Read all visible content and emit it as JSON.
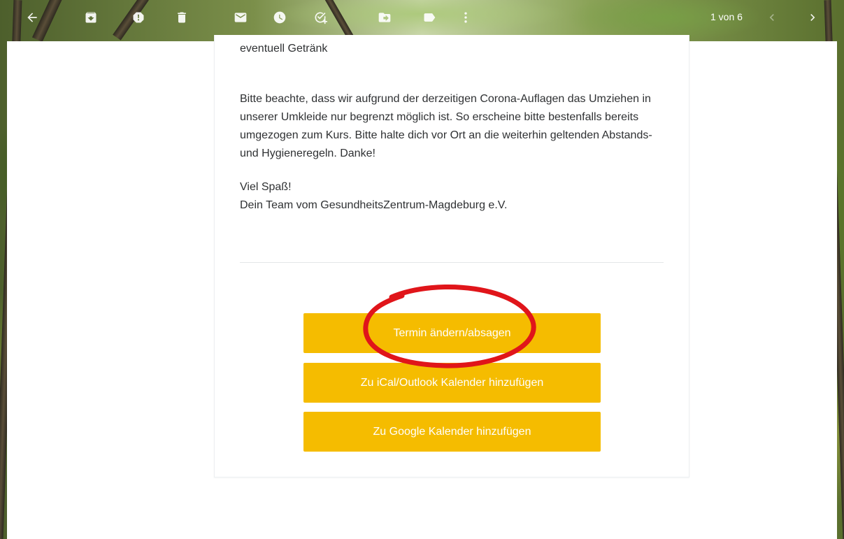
{
  "toolbar": {
    "icons": [
      "back-arrow-icon",
      "archive-icon",
      "report-spam-icon",
      "delete-icon",
      "mark-unread-icon",
      "snooze-icon",
      "add-to-tasks-icon",
      "move-to-icon",
      "label-icon",
      "more-vert-icon"
    ],
    "pager": "1 von 6"
  },
  "email": {
    "line_top": "eventuell Getränk",
    "paragraph_corona": "Bitte beachte, dass wir aufgrund der derzeitigen Corona-Auflagen das Umziehen in unserer Umkleide nur begrenzt möglich ist. So erscheine bitte bestenfalls bereits umgezogen zum Kurs. Bitte halte dich vor Ort an die weiterhin geltenden Abstands- und Hygieneregeln. Danke!",
    "greeting": "Viel Spaß!",
    "signature": "Dein Team vom GesundheitsZentrum-Magdeburg e.V."
  },
  "buttons": {
    "change_cancel": "Termin ändern/absagen",
    "ical_outlook": "Zu iCal/Outlook Kalender hinzufügen",
    "google_calendar": "Zu Google Kalender hinzufügen"
  },
  "colors": {
    "button_bg": "#f5bc00",
    "annotation_red": "#e0151a"
  }
}
